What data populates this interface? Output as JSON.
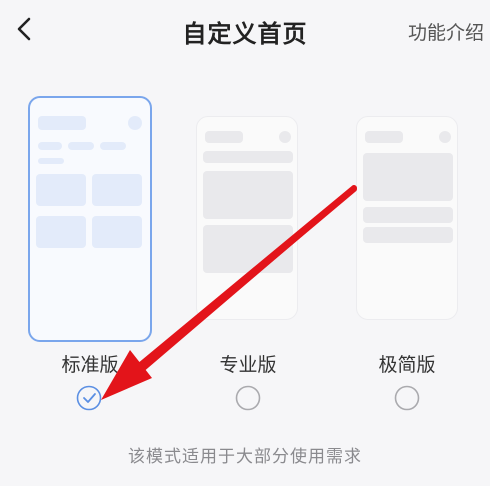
{
  "header": {
    "back_icon": "chevron-left-icon",
    "title": "自定义首页",
    "feature_link": "功能介绍"
  },
  "modes": [
    {
      "label": "标准版",
      "selected": true
    },
    {
      "label": "专业版",
      "selected": false
    },
    {
      "label": "极简版",
      "selected": false
    }
  ],
  "footer": {
    "description": "该模式适用于大部分使用需求"
  },
  "colors": {
    "accent": "#5b8fe3",
    "arrow": "#e3141a",
    "background": "#f6f6f8"
  }
}
